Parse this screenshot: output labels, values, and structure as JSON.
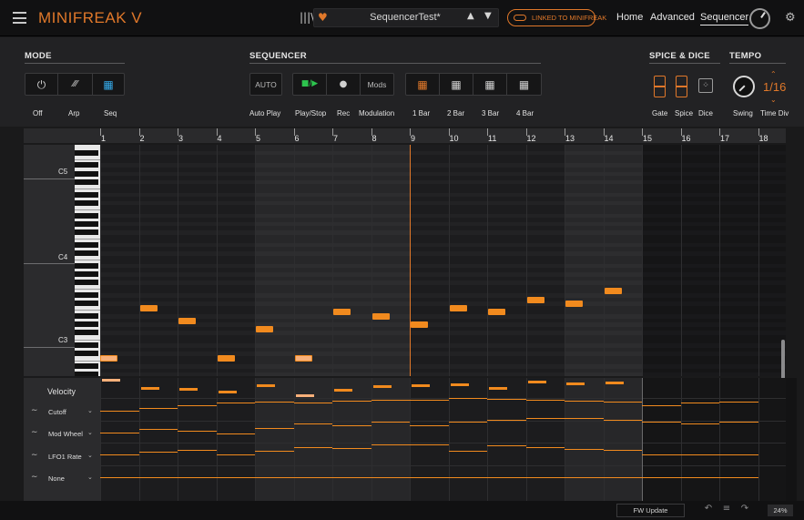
{
  "app": {
    "title": "MINIFREAK V"
  },
  "header": {
    "preset_name": "SequencerTest*",
    "linked_label": "LINKED TO MINIFREAK",
    "nav": [
      "Home",
      "Advanced",
      "Sequencer"
    ],
    "active_nav": "Sequencer"
  },
  "mode": {
    "title": "MODE",
    "buttons": [
      {
        "label": "Off",
        "icon": "power-icon"
      },
      {
        "label": "Arp",
        "icon": "arp-icon"
      },
      {
        "label": "Seq",
        "icon": "sequence-grid-icon",
        "active": true
      }
    ]
  },
  "sequencer": {
    "title": "SEQUENCER",
    "auto_label": "AUTO",
    "mods_label": "Mods",
    "labels": [
      "Auto Play",
      "Play/Stop",
      "Rec",
      "Modulation",
      "1 Bar",
      "2 Bar",
      "3 Bar",
      "4 Bar"
    ]
  },
  "spice_dice": {
    "title": "SPICE & DICE",
    "labels": [
      "Gate",
      "Spice",
      "Dice"
    ]
  },
  "tempo": {
    "title": "TEMPO",
    "labels": [
      "Swing",
      "Time Div"
    ],
    "time_div_value": "1/16"
  },
  "ruler": {
    "bars": [
      "1",
      "2",
      "3",
      "4",
      "5",
      "6",
      "7",
      "8",
      "9",
      "10",
      "11",
      "12",
      "13",
      "14",
      "15",
      "16",
      "17",
      "18"
    ]
  },
  "piano": {
    "octaves": [
      "C5",
      "C4",
      "C3"
    ]
  },
  "chart_data": {
    "type": "table",
    "steps": [
      1,
      2,
      3,
      4,
      5,
      6,
      7,
      8,
      9,
      10,
      11,
      12,
      13,
      14
    ],
    "notes": [
      "C3",
      "C4",
      "A3",
      "C3",
      "G3",
      "C3",
      "B3",
      "A#3",
      "G#3",
      "C4",
      "B3",
      "D4",
      "C#4",
      "E4"
    ]
  },
  "lanes": {
    "velocity_title": "Velocity",
    "names": [
      "Cutoff",
      "Mod Wheel",
      "LFO1 Rate",
      "None"
    ]
  },
  "status": {
    "fw_update": "FW Update",
    "cpu": "24%"
  }
}
